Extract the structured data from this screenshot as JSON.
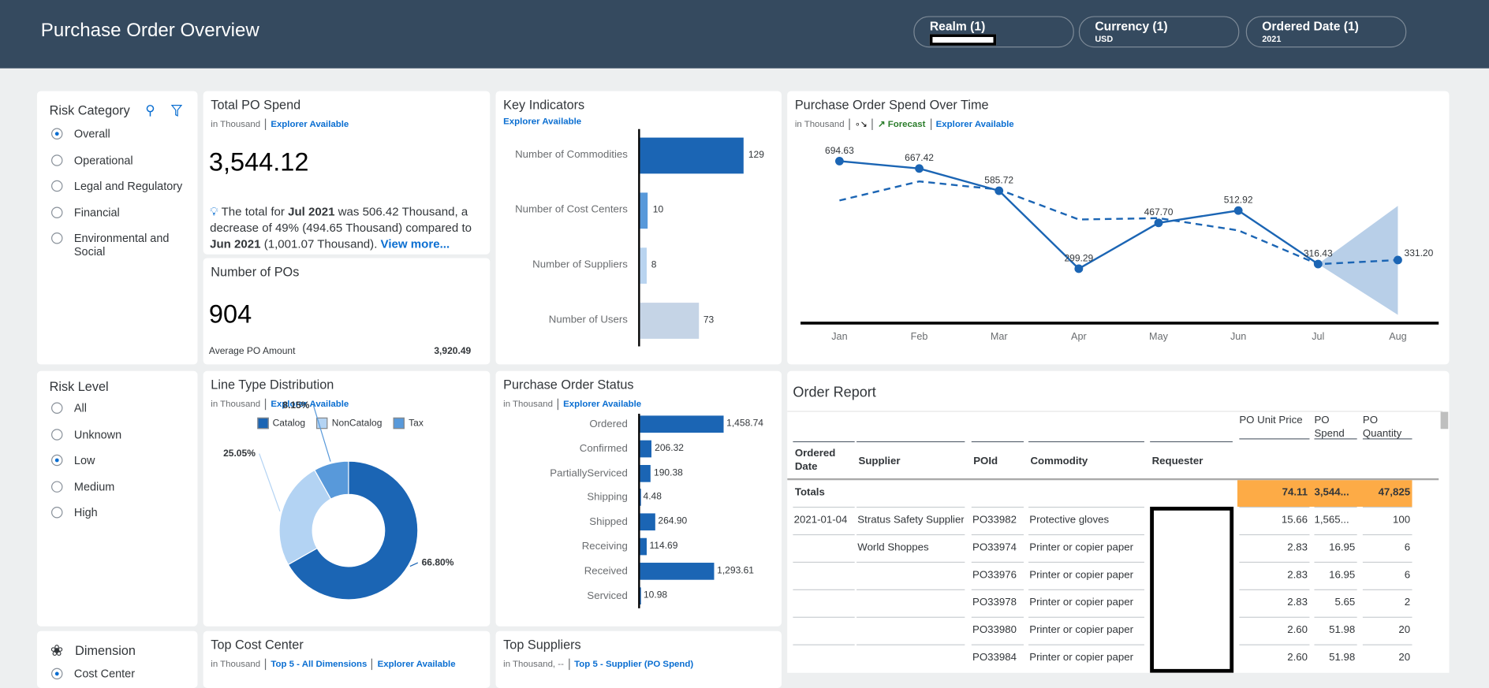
{
  "header": {
    "title": "Purchase Order Overview",
    "filters": [
      {
        "label": "Realm (1)",
        "value": ""
      },
      {
        "label": "Currency (1)",
        "value": "USD"
      },
      {
        "label": "Ordered Date (1)",
        "value": "2021"
      }
    ]
  },
  "risk_category": {
    "title": "Risk Category",
    "options": [
      "Overall",
      "Operational",
      "Legal and Regulatory",
      "Financial",
      "Environmental and Social"
    ],
    "selected": "Overall"
  },
  "total_po_spend": {
    "title": "Total PO Spend",
    "unit": "in Thousand",
    "explorer": "Explorer Available",
    "value": "3,544.12",
    "insight": {
      "p1": "The total for ",
      "b1": "Jul 2021",
      "p2": " was 506.42 Thousand, a decrease of 49% (494.65 Thousand) compared to ",
      "b2": "Jun 2021",
      "p3": " (1,001.07 Thousand). ",
      "link": "View more..."
    }
  },
  "number_of_pos": {
    "title": "Number of POs",
    "value": "904",
    "avg_label": "Average PO Amount",
    "avg_value": "3,920.49"
  },
  "key_indicators": {
    "title": "Key Indicators",
    "explorer": "Explorer Available",
    "items": [
      {
        "label": "Number of Commodities",
        "value": 129,
        "display": "129",
        "color": "#1b65b4"
      },
      {
        "label": "Number of Cost Centers",
        "value": 10,
        "display": "10",
        "color": "#5899da"
      },
      {
        "label": "Number of Suppliers",
        "value": 8,
        "display": "8",
        "color": "#b9d4f0"
      },
      {
        "label": "Number of Users",
        "value": 73,
        "display": "73",
        "color": "#c5d4e6"
      }
    ]
  },
  "spend_over_time": {
    "title": "Purchase Order Spend Over Time",
    "unit": "in Thousand",
    "forecast": "Forecast",
    "explorer": "Explorer Available"
  },
  "risk_level": {
    "title": "Risk Level",
    "options": [
      "All",
      "Unknown",
      "Low",
      "Medium",
      "High"
    ],
    "selected": "Low"
  },
  "line_type": {
    "title": "Line Type Distribution",
    "unit": "in Thousand",
    "explorer": "Explorer Available"
  },
  "po_status": {
    "title": "Purchase Order Status",
    "unit": "in Thousand",
    "explorer": "Explorer Available"
  },
  "order_report": {
    "title": "Order Report",
    "columns": [
      "Ordered Date",
      "Supplier",
      "POId",
      "Commodity",
      "Requester",
      "PO Unit Price",
      "PO Spend",
      "PO Quantity"
    ],
    "totals": {
      "label": "Totals",
      "unit_price": "74.11",
      "spend": "3,544...",
      "quantity": "47,825"
    },
    "rows": [
      [
        "2021-01-04",
        "Stratus Safety Supplier",
        "PO33982",
        "Protective gloves",
        "",
        "15.66",
        "1,565...",
        "100"
      ],
      [
        "",
        "World Shoppes",
        "PO33974",
        "Printer or copier paper",
        "",
        "2.83",
        "16.95",
        "6"
      ],
      [
        "",
        "",
        "PO33976",
        "Printer or copier paper",
        "",
        "2.83",
        "16.95",
        "6"
      ],
      [
        "",
        "",
        "PO33978",
        "Printer or copier paper",
        "",
        "2.83",
        "5.65",
        "2"
      ],
      [
        "",
        "",
        "PO33980",
        "Printer or copier paper",
        "",
        "2.60",
        "51.98",
        "20"
      ],
      [
        "",
        "",
        "PO33984",
        "Printer or copier paper",
        "",
        "2.60",
        "51.98",
        "20"
      ]
    ],
    "totals_color": "#fdab46"
  },
  "dimension": {
    "title": "Dimension",
    "first_option": "Cost Center"
  },
  "top_cost_center": {
    "title": "Top Cost Center",
    "unit": "in Thousand",
    "top5": "Top 5 - All Dimensions",
    "explorer": "Explorer Available"
  },
  "top_suppliers": {
    "title": "Top Suppliers",
    "unit": "in Thousand, --",
    "top5": "Top 5 - Supplier (PO Spend)"
  },
  "chart_data": [
    {
      "type": "line",
      "title": "Purchase Order Spend Over Time",
      "categories": [
        "Jan",
        "Feb",
        "Mar",
        "Apr",
        "May",
        "Jun",
        "Jul",
        "Aug"
      ],
      "series": [
        {
          "values": [
            694.63,
            667.42,
            585.72,
            299.29,
            467.7,
            512.92,
            316.43,
            null
          ],
          "style": "solid"
        },
        {
          "values": [
            550,
            620,
            590,
            480,
            485,
            440,
            316,
            331.2
          ],
          "style": "dashed"
        }
      ],
      "forecast": {
        "category": "Aug",
        "value": 331.2,
        "lower": 130,
        "upper": 530
      },
      "ylim": [
        150,
        760
      ],
      "color": "#1b65b4",
      "band_color": "#b8cfe8"
    },
    {
      "type": "pie",
      "title": "Line Type Distribution",
      "legend": [
        "Catalog",
        "NonCatalog",
        "Tax"
      ],
      "values": [
        66.8,
        25.05,
        8.15
      ],
      "labels": [
        "66.80%",
        "25.05%",
        "8.15%"
      ],
      "colors": [
        "#1b65b4",
        "#b3d3f3",
        "#5899da"
      ],
      "legend_placement": "top"
    },
    {
      "type": "bar",
      "title": "Purchase Order Status",
      "categories": [
        "Ordered",
        "Confirmed",
        "PartiallyServiced",
        "Shipping",
        "Shipped",
        "Receiving",
        "Received",
        "Serviced"
      ],
      "values": [
        1458.74,
        206.32,
        190.38,
        4.48,
        264.9,
        114.69,
        1293.61,
        10.98
      ],
      "labels": [
        "1,458.74",
        "206.32",
        "190.38",
        "4.48",
        "264.90",
        "114.69",
        "1,293.61",
        "10.98"
      ],
      "color": "#1b65b4"
    }
  ]
}
